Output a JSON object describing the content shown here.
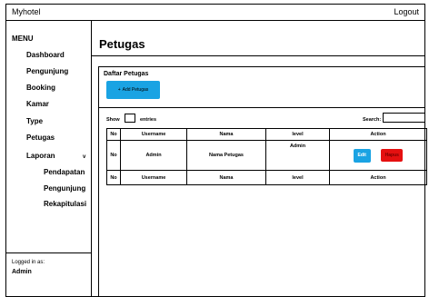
{
  "app": {
    "title": "Myhotel",
    "logout_label": "Logout"
  },
  "sidebar": {
    "menu_title": "MENU",
    "items": [
      {
        "label": "Dashboard"
      },
      {
        "label": "Pengunjung"
      },
      {
        "label": "Booking"
      },
      {
        "label": "Kamar"
      },
      {
        "label": "Type"
      },
      {
        "label": "Petugas"
      },
      {
        "label": "Laporan"
      }
    ],
    "laporan_chevron": "v",
    "sub_items": [
      {
        "label": "Pendapatan"
      },
      {
        "label": "Pengunjung"
      },
      {
        "label": "Rekapitulasi"
      }
    ],
    "logged_in_label": "Logged in as:",
    "logged_in_user": "Admin"
  },
  "main": {
    "page_title": "Petugas",
    "panel_title": "Daftar Petugas",
    "add_button": {
      "icon": "plus-icon",
      "plus": "+",
      "label": "Add Petugas"
    },
    "show_label": "Show",
    "entries_label": "entries",
    "search_label": "Search:"
  },
  "table": {
    "headers": [
      "No",
      "Username",
      "Nama",
      "level",
      "Action"
    ],
    "rows": [
      {
        "no": "No",
        "username": "Admin",
        "nama": "Nama Petugas",
        "level": "Admin",
        "edit_label": "Edit",
        "delete_label": "Hapus"
      }
    ],
    "footer": [
      "No",
      "Username",
      "Nama",
      "level",
      "Action"
    ]
  },
  "colors": {
    "primary_button": "#1aa3e3",
    "danger_button": "#e51010"
  }
}
